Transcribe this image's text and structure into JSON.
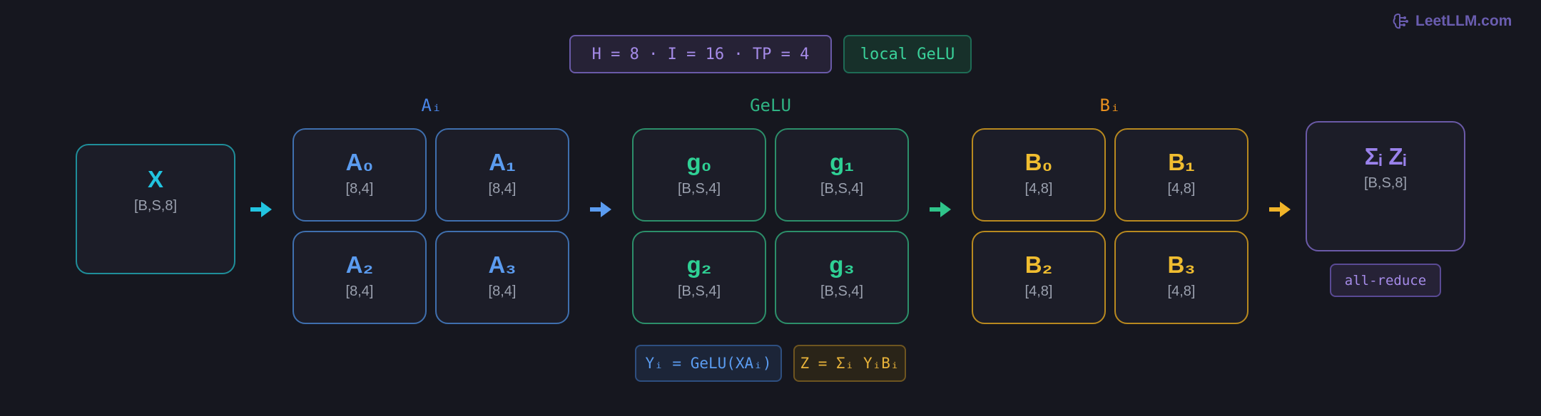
{
  "brand": {
    "text": "LeetLLM.com",
    "icon": "brain-icon",
    "color": "#6a5db0"
  },
  "params": {
    "label": "H = 8 · I = 16 · TP = 4",
    "color": "#a58be8"
  },
  "mode": {
    "label": "local GeLU",
    "color": "#3ad19a"
  },
  "columns": {
    "a": {
      "title": "Aᵢ",
      "color": "#4a86e8"
    },
    "g": {
      "title": "GeLU",
      "color": "#2fb383"
    },
    "b": {
      "title": "Bᵢ",
      "color": "#e8901f"
    }
  },
  "input": {
    "title": "X",
    "shape": "[B,S,8]",
    "color": "#22c4e0"
  },
  "a_blocks": [
    {
      "title": "A₀",
      "shape": "[8,4]"
    },
    {
      "title": "A₁",
      "shape": "[8,4]"
    },
    {
      "title": "A₂",
      "shape": "[8,4]"
    },
    {
      "title": "A₃",
      "shape": "[8,4]"
    }
  ],
  "g_blocks": [
    {
      "title": "g₀",
      "shape": "[B,S,4]"
    },
    {
      "title": "g₁",
      "shape": "[B,S,4]"
    },
    {
      "title": "g₂",
      "shape": "[B,S,4]"
    },
    {
      "title": "g₃",
      "shape": "[B,S,4]"
    }
  ],
  "b_blocks": [
    {
      "title": "B₀",
      "shape": "[4,8]"
    },
    {
      "title": "B₁",
      "shape": "[4,8]"
    },
    {
      "title": "B₂",
      "shape": "[4,8]"
    },
    {
      "title": "B₃",
      "shape": "[4,8]"
    }
  ],
  "output": {
    "title": "Σᵢ Zᵢ",
    "shape": "[B,S,8]",
    "color": "#9a82ec"
  },
  "reduce": {
    "label": "all-reduce",
    "color": "#a58be8"
  },
  "formulas": {
    "y": {
      "label": "Yᵢ = GeLU(XAᵢ)",
      "color": "#5b9cf0"
    },
    "z": {
      "label": "Z = Σᵢ YᵢBᵢ",
      "color": "#e8b33a"
    }
  },
  "colors": {
    "blue_title": "#5b9cf0",
    "green_title": "#2fd195",
    "yellow_title": "#f0bd30",
    "arrow_cyan": "#22c4e0",
    "arrow_blue": "#5b9cf0",
    "arrow_green": "#2fc48a",
    "arrow_yellow": "#f0b429"
  }
}
